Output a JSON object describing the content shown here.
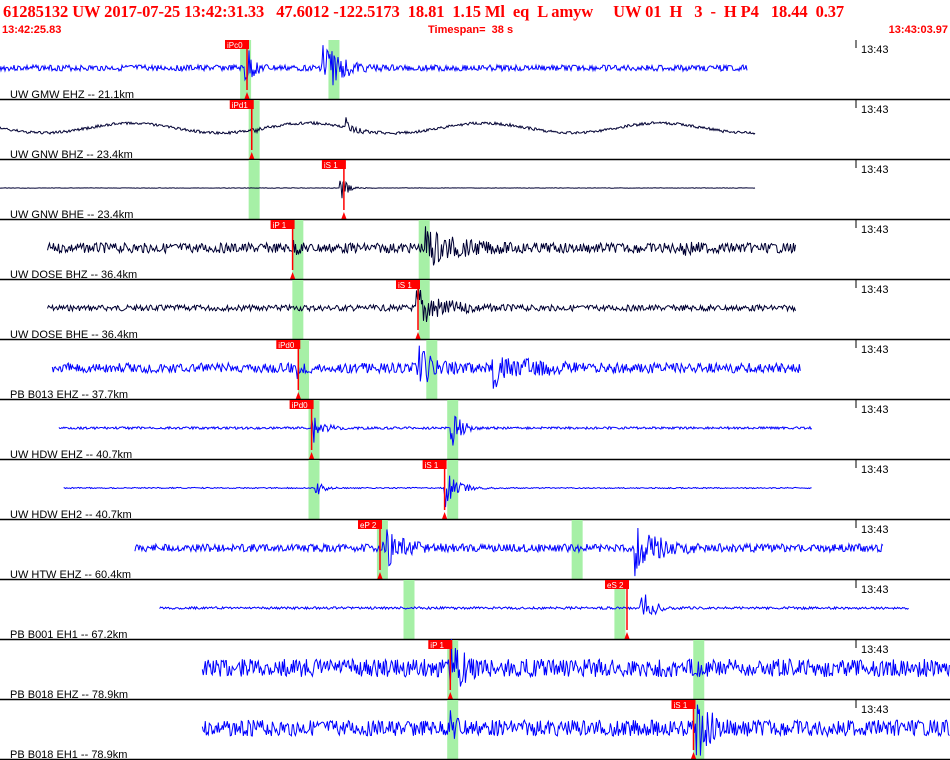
{
  "header": {
    "title": "61285132 UW 2017-07-25 13:42:31.33   47.6012 -122.5173  18.81  1.15 Ml  eq  L amyw     UW 01  H   3  -  H P4   18.44  0.37",
    "start_time": "13:42:25.83",
    "timespan": "Timespan=  38 s",
    "end_time": "13:43:03.97"
  },
  "minute_label": "13:43",
  "colors": {
    "header_text": "#ff0000",
    "trace_blue": "#0000ff",
    "trace_black": "#000033",
    "pick_red": "#ff0000",
    "arrival_window": "#a6f0a6",
    "separator": "#000000",
    "label_text": "#000000"
  },
  "traces": [
    {
      "label": "UW GMW EHZ -- 21.1km",
      "color": "blue",
      "type": "noisy",
      "start": 0.0,
      "end": 0.787,
      "amp": 3,
      "envelope": [
        [
          0.26,
          0.7,
          22,
          6
        ],
        [
          0.34,
          0.8,
          32,
          14
        ]
      ],
      "green": [
        0.258,
        0.351
      ],
      "picks": [
        {
          "label": "iPc0",
          "x": 0.26,
          "side": "top"
        }
      ]
    },
    {
      "label": "UW GNW BHZ -- 23.4km",
      "color": "black",
      "type": "wave",
      "start": 0.0,
      "end": 0.795,
      "amp": 7,
      "envelope": [
        [
          0.27,
          0.5,
          8,
          4
        ],
        [
          0.365,
          1.0,
          26,
          10
        ]
      ],
      "green": [
        0.267
      ],
      "picks": [
        {
          "label": "iPd1",
          "x": 0.265,
          "side": "top"
        }
      ]
    },
    {
      "label": "UW GNW BHE -- 23.4km",
      "color": "black",
      "type": "flat",
      "start": 0.0,
      "end": 0.795,
      "amp": 0.4,
      "envelope": [
        [
          0.36,
          1.0,
          24,
          6
        ]
      ],
      "green": [
        0.267
      ],
      "picks": [
        {
          "label": "iS 1",
          "x": 0.362,
          "side": "top"
        }
      ]
    },
    {
      "label": "UW DOSE BHZ -- 36.4km",
      "color": "black",
      "type": "noisy",
      "start": 0.05,
      "end": 0.838,
      "amp": 5,
      "envelope": [
        [
          0.31,
          0.4,
          5,
          4
        ],
        [
          0.45,
          0.9,
          18,
          25
        ],
        [
          0.72,
          0.5,
          6,
          8
        ]
      ],
      "green": [
        0.313,
        0.446
      ],
      "picks": [
        {
          "label": "iP 1",
          "x": 0.308,
          "side": "top"
        }
      ]
    },
    {
      "label": "UW DOSE BHE -- 36.4km",
      "color": "black",
      "type": "noisy",
      "start": 0.05,
      "end": 0.838,
      "amp": 3,
      "envelope": [
        [
          0.44,
          1.0,
          22,
          22
        ]
      ],
      "green": [
        0.313,
        0.446
      ],
      "picks": [
        {
          "label": "iS 1",
          "x": 0.44,
          "side": "top"
        }
      ]
    },
    {
      "label": "PB B013 EHZ -- 37.7km",
      "color": "blue",
      "type": "noisy",
      "start": 0.055,
      "end": 0.843,
      "amp": 5,
      "envelope": [
        [
          0.315,
          0.5,
          6,
          6
        ],
        [
          0.44,
          0.9,
          20,
          12
        ],
        [
          0.52,
          0.8,
          16,
          30
        ]
      ],
      "green": [
        0.319,
        0.454
      ],
      "picks": [
        {
          "label": "iPd0",
          "x": 0.314,
          "side": "top"
        }
      ]
    },
    {
      "label": "UW HDW EHZ -- 40.7km",
      "color": "blue",
      "type": "noisy",
      "start": 0.062,
      "end": 0.855,
      "amp": 1.2,
      "envelope": [
        [
          0.33,
          1.0,
          18,
          8
        ],
        [
          0.476,
          1.0,
          22,
          8
        ]
      ],
      "green": [
        0.33,
        0.476
      ],
      "picks": [
        {
          "label": "iPd0",
          "x": 0.328,
          "side": "top"
        }
      ]
    },
    {
      "label": "UW HDW EH2 -- 40.7km",
      "color": "blue",
      "type": "noisy",
      "start": 0.067,
      "end": 0.855,
      "amp": 0.6,
      "envelope": [
        [
          0.334,
          0.8,
          8,
          6
        ],
        [
          0.47,
          1.0,
          24,
          10
        ]
      ],
      "green": [
        0.33,
        0.476
      ],
      "picks": [
        {
          "label": "iS 1",
          "x": 0.468,
          "side": "top"
        }
      ]
    },
    {
      "label": "UW HTW EHZ -- 60.4km",
      "color": "blue",
      "type": "noisy",
      "start": 0.142,
      "end": 0.93,
      "amp": 4,
      "envelope": [
        [
          0.405,
          0.8,
          18,
          16
        ],
        [
          0.67,
          1.0,
          26,
          20
        ]
      ],
      "green": [
        0.402,
        0.607
      ],
      "picks": [
        {
          "label": "eP 2",
          "x": 0.4,
          "side": "top"
        }
      ]
    },
    {
      "label": "PB B001 EH1 -- 67.2km",
      "color": "blue",
      "type": "noisy",
      "start": 0.168,
      "end": 0.957,
      "amp": 1.2,
      "envelope": [
        [
          0.676,
          1.0,
          26,
          8
        ]
      ],
      "green": [
        0.43,
        0.652
      ],
      "picks": [
        {
          "label": "eS 2",
          "x": 0.66,
          "side": "top"
        }
      ]
    },
    {
      "label": "PB B018 EHZ -- 78.9km",
      "color": "blue",
      "type": "noisy",
      "start": 0.213,
      "end": 1.0,
      "amp": 9,
      "envelope": [
        [
          0.476,
          1.0,
          22,
          10
        ]
      ],
      "green": [
        0.476,
        0.735
      ],
      "picks": [
        {
          "label": "iP 1",
          "x": 0.474,
          "side": "top"
        }
      ]
    },
    {
      "label": "PB B018 EH1 -- 78.9km",
      "color": "blue",
      "type": "noisy",
      "start": 0.213,
      "end": 1.0,
      "amp": 8,
      "envelope": [
        [
          0.735,
          1.0,
          24,
          12
        ],
        [
          0.476,
          0.7,
          10,
          8
        ]
      ],
      "green": [
        0.476,
        0.735
      ],
      "picks": [
        {
          "label": "iS 1",
          "x": 0.73,
          "side": "top"
        }
      ]
    }
  ]
}
